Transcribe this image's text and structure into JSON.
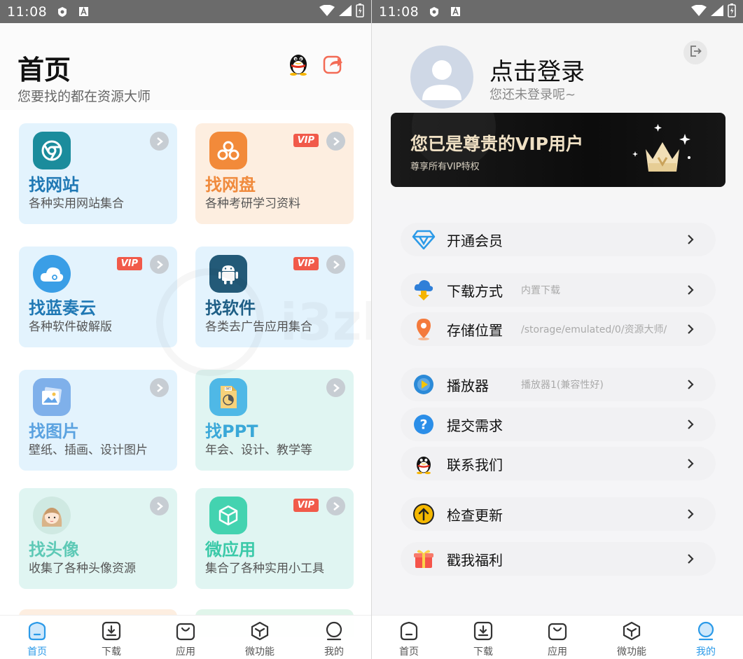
{
  "status_bar": {
    "time": "11:08"
  },
  "home": {
    "title": "首页",
    "subtitle": "您要找的都在资源大师",
    "vip_badge": "VIP",
    "cards": [
      {
        "title": "找网站",
        "desc": "各种实用网站集合",
        "vip": false,
        "title_color": "#1f78b4"
      },
      {
        "title": "找网盘",
        "desc": "各种考研学习资料",
        "vip": true,
        "title_color": "#f08a3c"
      },
      {
        "title": "找蓝奏云",
        "desc": "各种软件破解版",
        "vip": true,
        "title_color": "#1f78b4"
      },
      {
        "title": "找软件",
        "desc": "各类去广告应用集合",
        "vip": true,
        "title_color": "#1f5f86"
      },
      {
        "title": "找图片",
        "desc": "壁纸、插画、设计图片",
        "vip": false,
        "title_color": "#5aa2e0"
      },
      {
        "title": "找PPT",
        "desc": "年会、设计、教学等",
        "vip": false,
        "title_color": "#3aa8d8"
      },
      {
        "title": "找头像",
        "desc": "收集了各种头像资源",
        "vip": false,
        "title_color": "#5ec9b6"
      },
      {
        "title": "微应用",
        "desc": "集合了各种实用小工具",
        "vip": true,
        "title_color": "#3ac9a8"
      }
    ]
  },
  "nav": {
    "items": [
      {
        "label": "首页",
        "icon": "home-icon"
      },
      {
        "label": "下载",
        "icon": "download-icon"
      },
      {
        "label": "应用",
        "icon": "bag-icon"
      },
      {
        "label": "微功能",
        "icon": "cube-icon"
      },
      {
        "label": "我的",
        "icon": "profile-icon"
      }
    ],
    "accent": "#2b9ae8"
  },
  "profile": {
    "login_title": "点击登录",
    "login_sub": "您还未登录呢~",
    "vip_title": "您已是尊贵的VIP用户",
    "vip_sub": "尊享所有VIP特权",
    "menu": [
      {
        "label": "开通会员",
        "value": ""
      },
      {
        "label": "下载方式",
        "value": "内置下载"
      },
      {
        "label": "存储位置",
        "value": "/storage/emulated/0/资源大师/"
      },
      {
        "label": "播放器",
        "value": "播放器1(兼容性好)"
      },
      {
        "label": "提交需求",
        "value": ""
      },
      {
        "label": "联系我们",
        "value": ""
      },
      {
        "label": "检查更新",
        "value": ""
      },
      {
        "label": "戳我福利",
        "value": ""
      }
    ]
  }
}
